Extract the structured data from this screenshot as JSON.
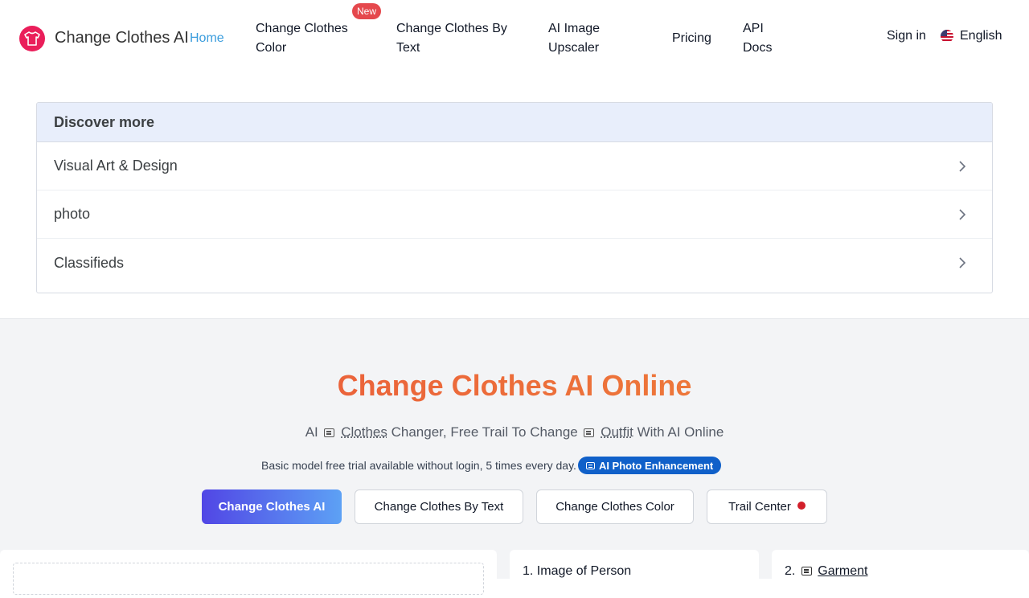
{
  "header": {
    "brand": "Change Clothes AI",
    "nav": {
      "home": "Home",
      "color": "Change Clothes Color",
      "new_badge": "New",
      "text": "Change Clothes By Text",
      "upscaler": "AI Image Upscaler",
      "pricing": "Pricing",
      "api": "API Docs"
    },
    "sign_in": "Sign in",
    "language": "English"
  },
  "discover": {
    "heading": "Discover more",
    "items": [
      "Visual Art & Design",
      "photo",
      "Classifieds"
    ]
  },
  "hero": {
    "title": "Change Clothes AI Online",
    "subtitle": {
      "part1": "AI",
      "word1": "Clothes",
      "part2": "Changer, Free Trail To Change",
      "word2": "Outfit",
      "part3": "With AI Online"
    },
    "trial_text": "Basic model free trial available without login, 5 times every day.",
    "enhancement_badge": "AI Photo Enhancement",
    "buttons": {
      "primary": "Change Clothes AI",
      "by_text": "Change Clothes By Text",
      "color": "Change Clothes Color",
      "trail": "Trail Center"
    }
  },
  "panels": {
    "person": "1. Image of Person",
    "garment_prefix": "2.",
    "garment": "Garment"
  },
  "colors": {
    "brand_red": "#ea1e5a",
    "link_blue": "#3b9ddd",
    "title_start": "#e8503a",
    "title_end": "#f08a3a",
    "badge_blue": "#1060c9"
  }
}
